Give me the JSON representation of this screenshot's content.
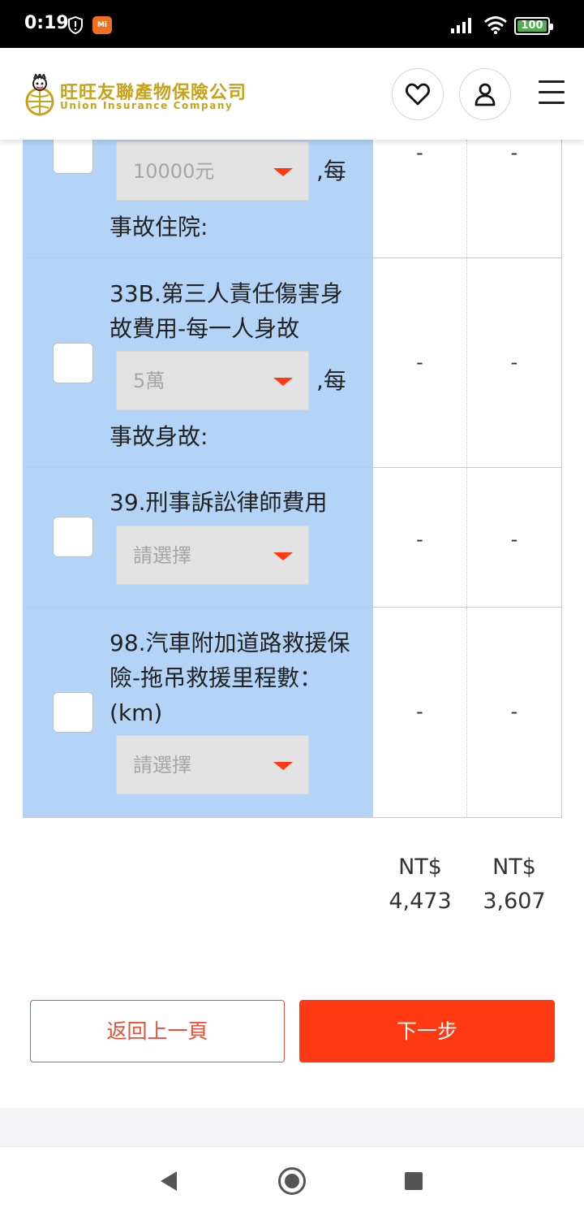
{
  "status_bar": {
    "time": "0:19",
    "battery": "100",
    "mi_badge": "Mi"
  },
  "header": {
    "logo_cn": "旺旺友聯產物保險公司",
    "logo_en": "Union Insurance Company",
    "heart_icon": "heart-icon",
    "user_icon": "user-icon",
    "menu_icon": "hamburger-menu-icon"
  },
  "colors": {
    "accent": "#ff3a12",
    "row_blue": "#b3d4f7",
    "logo_gold": "#c8a21a",
    "select_gray": "#e2e2e2"
  },
  "rows": [
    {
      "select_value": "10000元",
      "suffix": ",每",
      "label_after": "事故住院:",
      "col1": "-",
      "col2": "-"
    },
    {
      "label_line1": "33B.第三人責任傷害身",
      "label_line2": "故費用-每一人身故",
      "select_value": "5萬",
      "suffix": ",每",
      "label_after": "事故身故:",
      "col1": "-",
      "col2": "-"
    },
    {
      "label_line1": "39.刑事訴訟律師費用",
      "select_value": "請選擇",
      "col1": "-",
      "col2": "-"
    },
    {
      "label_line1": "98.汽車附加道路救援保",
      "label_line2": "險-拖吊救援里程數：",
      "label_line3": "(km)",
      "select_value": "請選擇",
      "col1": "-",
      "col2": "-"
    }
  ],
  "totals": [
    {
      "currency": "NT$",
      "amount": "4,473"
    },
    {
      "currency": "NT$",
      "amount": "3,607"
    }
  ],
  "actions": {
    "back_label": "返回上一頁",
    "next_label": "下一步"
  }
}
